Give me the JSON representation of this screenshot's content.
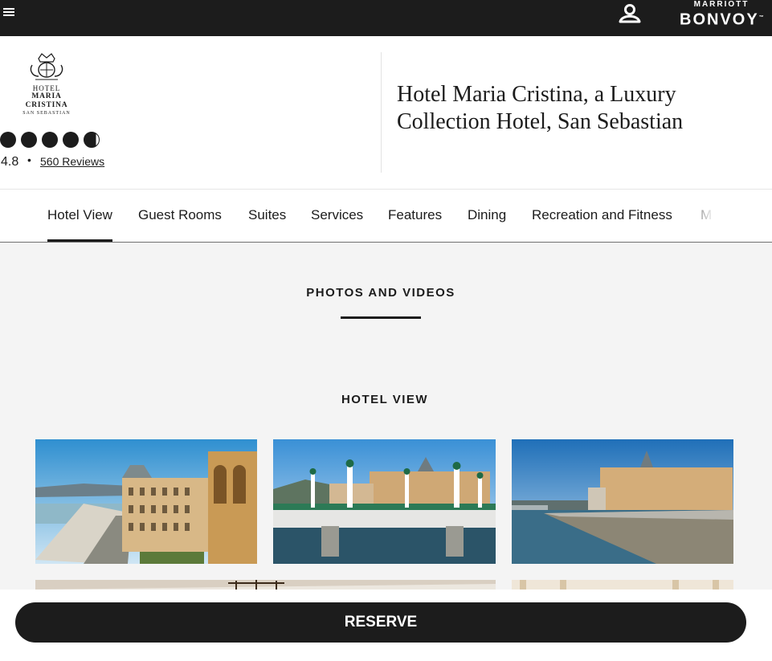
{
  "topbar": {
    "menu_icon": "hamburger-menu-icon",
    "profile_icon": "user-profile-icon",
    "brand_small": "MARRIOTT",
    "brand_big": "BONVOY",
    "brand_trademark": "™"
  },
  "hotel": {
    "logo_line1": "HOTEL",
    "logo_line2": "MARIA CRISTINA",
    "logo_line3": "SAN SEBASTIAN",
    "rating_score": "4.8",
    "rating_separator": "•",
    "rating_value": 4.8,
    "reviews_link": "560 Reviews",
    "name": "Hotel Maria Cristina, a Luxury Collection Hotel, San Sebastian"
  },
  "nav": {
    "tabs": [
      {
        "label": "Hotel View",
        "active": true
      },
      {
        "label": "Guest Rooms"
      },
      {
        "label": "Suites"
      },
      {
        "label": "Services"
      },
      {
        "label": "Features"
      },
      {
        "label": "Dining"
      },
      {
        "label": "Recreation and Fitness"
      },
      {
        "label": "M"
      }
    ]
  },
  "main": {
    "section_title": "PHOTOS AND VIDEOS",
    "gallery_title": "HOTEL VIEW"
  },
  "reserve": {
    "label": "RESERVE"
  }
}
